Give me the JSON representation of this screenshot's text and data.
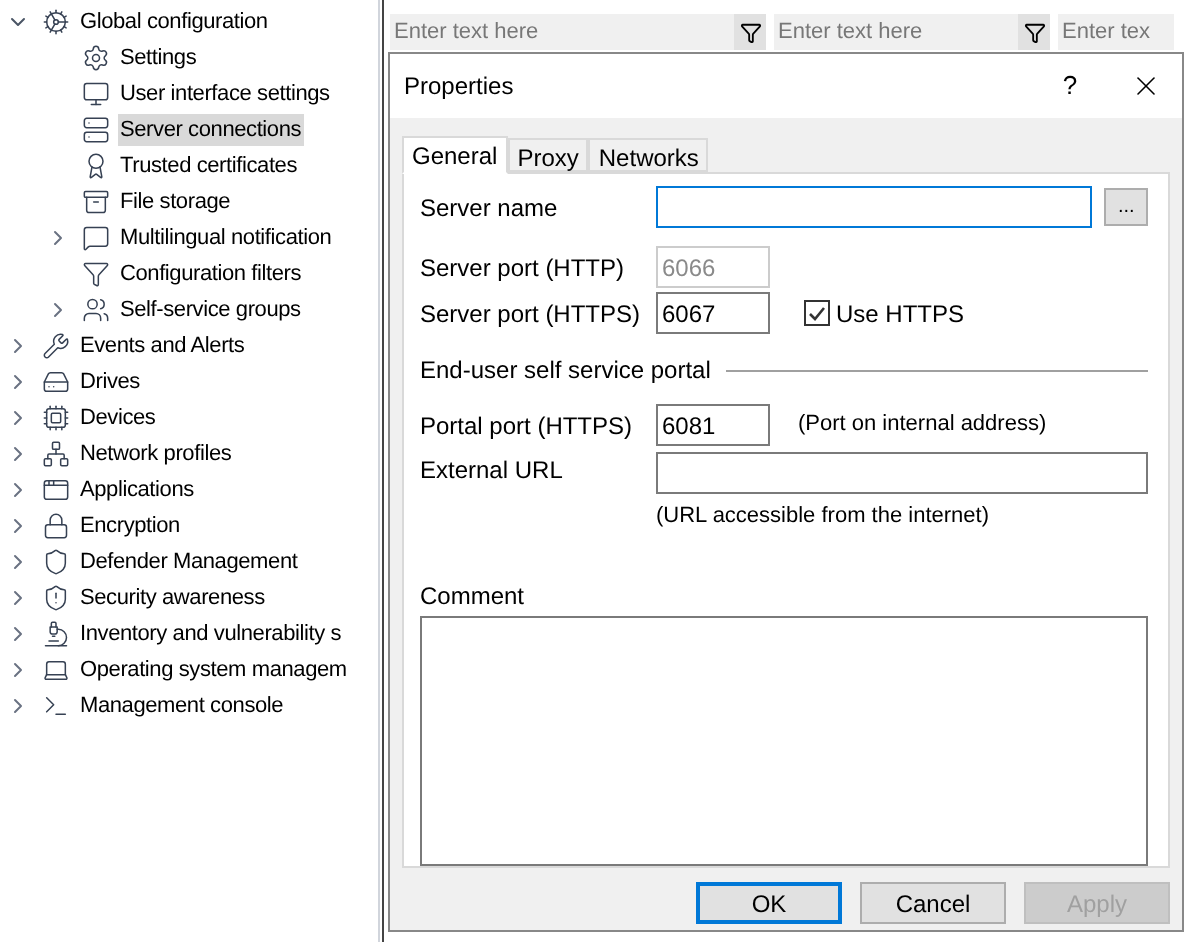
{
  "tree": [
    {
      "label": "Global configuration",
      "expanded": true,
      "selected": false,
      "children": [
        {
          "label": "Settings",
          "selected": false
        },
        {
          "label": "User interface settings",
          "selected": false
        },
        {
          "label": "Server connections",
          "selected": true
        },
        {
          "label": "Trusted certificates",
          "selected": false
        },
        {
          "label": "File storage",
          "selected": false
        },
        {
          "label": "Multilingual notification",
          "expanded": false,
          "selected": false
        },
        {
          "label": "Configuration filters",
          "selected": false
        },
        {
          "label": "Self-service groups",
          "expanded": false,
          "selected": false
        }
      ]
    },
    {
      "label": "Events and Alerts",
      "expanded": false,
      "selected": false
    },
    {
      "label": "Drives",
      "expanded": false,
      "selected": false
    },
    {
      "label": "Devices",
      "expanded": false,
      "selected": false
    },
    {
      "label": "Network profiles",
      "expanded": false,
      "selected": false
    },
    {
      "label": "Applications",
      "expanded": false,
      "selected": false
    },
    {
      "label": "Encryption",
      "expanded": false,
      "selected": false
    },
    {
      "label": "Defender Management",
      "expanded": false,
      "selected": false
    },
    {
      "label": "Security awareness",
      "expanded": false,
      "selected": false
    },
    {
      "label": "Inventory and vulnerability s",
      "expanded": false,
      "selected": false
    },
    {
      "label": "Operating system managem",
      "expanded": false,
      "selected": false
    },
    {
      "label": "Management console",
      "expanded": false,
      "selected": false
    }
  ],
  "filters": [
    {
      "placeholder": "Enter text here"
    },
    {
      "placeholder": "Enter text here"
    },
    {
      "placeholder": "Enter tex"
    }
  ],
  "dialog": {
    "title": "Properties",
    "help": "?",
    "tabs": [
      {
        "label": "General",
        "selected": true
      },
      {
        "label": "Proxy",
        "selected": false
      },
      {
        "label": "Networks",
        "selected": false
      }
    ],
    "server_name": {
      "label": "Server name",
      "browse": "..."
    },
    "http_port": {
      "label": "Server port (HTTP)",
      "value": "6066",
      "disabled": true
    },
    "https_port": {
      "label": "Server port (HTTPS)",
      "value": "6067",
      "disabled": false
    },
    "use_https": {
      "label": "Use HTTPS",
      "checked": true
    },
    "portal_section": "End-user self service portal",
    "portal_port": {
      "label": "Portal port (HTTPS)",
      "value": "6081",
      "note": "(Port on internal address)"
    },
    "external_url": {
      "label": "External URL",
      "note": "(URL accessible from the internet)"
    },
    "comment": {
      "label": "Comment"
    },
    "buttons": [
      {
        "label": "OK",
        "default": true,
        "disabled": false
      },
      {
        "label": "Cancel",
        "default": false,
        "disabled": false
      },
      {
        "label": "Apply",
        "default": false,
        "disabled": true
      }
    ]
  }
}
